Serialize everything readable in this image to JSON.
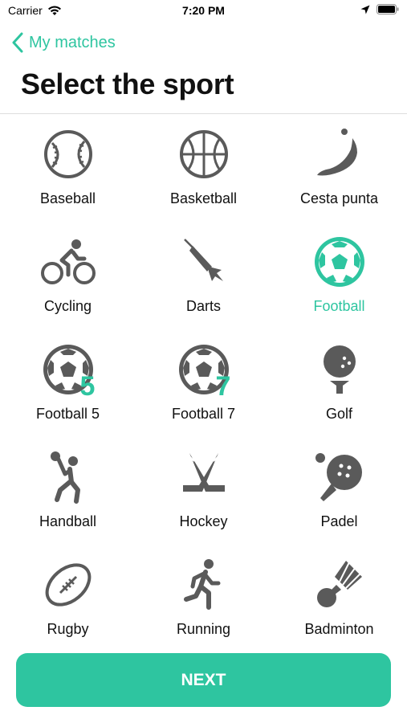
{
  "status": {
    "carrier": "Carrier",
    "time": "7:20 PM"
  },
  "nav": {
    "back_label": "My matches"
  },
  "page": {
    "title": "Select the sport"
  },
  "sports": [
    {
      "label": "Baseball",
      "icon": "baseball-icon",
      "selected": false
    },
    {
      "label": "Basketball",
      "icon": "basketball-icon",
      "selected": false
    },
    {
      "label": "Cesta punta",
      "icon": "cesta-punta-icon",
      "selected": false
    },
    {
      "label": "Cycling",
      "icon": "cycling-icon",
      "selected": false
    },
    {
      "label": "Darts",
      "icon": "dart-icon",
      "selected": false
    },
    {
      "label": "Football",
      "icon": "football-icon",
      "selected": true
    },
    {
      "label": "Football 5",
      "icon": "football-5-icon",
      "badge": "5",
      "selected": false
    },
    {
      "label": "Football 7",
      "icon": "football-7-icon",
      "badge": "7",
      "selected": false
    },
    {
      "label": "Golf",
      "icon": "golf-icon",
      "selected": false
    },
    {
      "label": "Handball",
      "icon": "handball-icon",
      "selected": false
    },
    {
      "label": "Hockey",
      "icon": "hockey-icon",
      "selected": false
    },
    {
      "label": "Padel",
      "icon": "padel-icon",
      "selected": false
    },
    {
      "label": "Rugby",
      "icon": "rugby-icon",
      "selected": false
    },
    {
      "label": "Running",
      "icon": "running-icon",
      "selected": false
    },
    {
      "label": "Badminton",
      "icon": "badminton-icon",
      "selected": false
    }
  ],
  "footer": {
    "next_label": "NEXT"
  },
  "colors": {
    "accent": "#2EC5A0",
    "icon": "#5a5a5a",
    "text": "#111111"
  }
}
